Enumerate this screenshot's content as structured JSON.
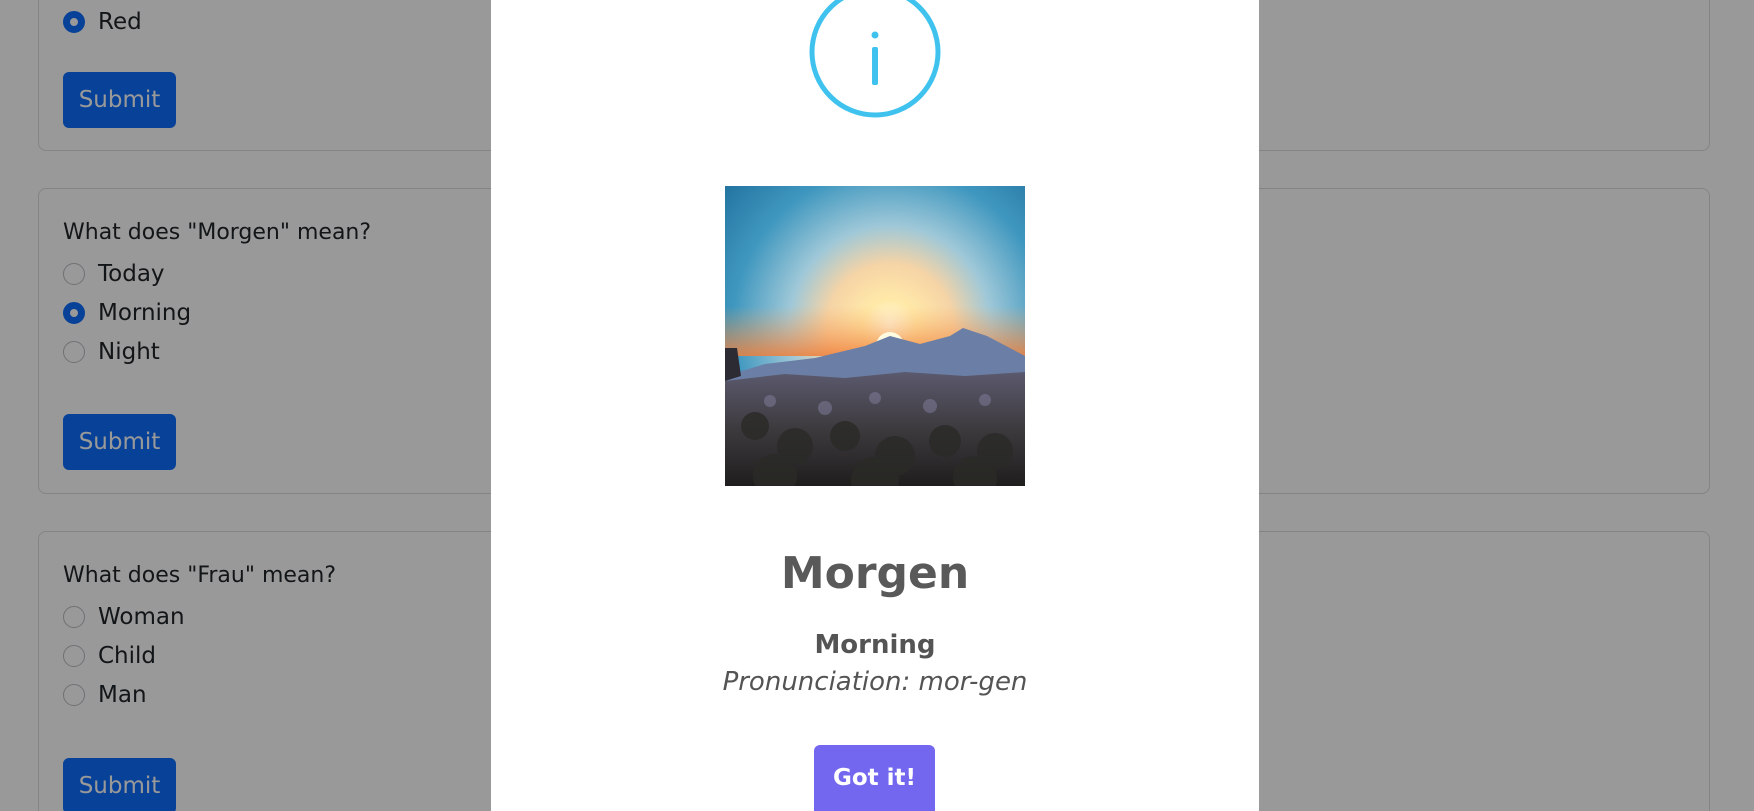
{
  "quiz": {
    "card1": {
      "options": [
        {
          "label": "Red",
          "checked": true
        }
      ],
      "submit_label": "Submit"
    },
    "card2": {
      "question": "What does \"Morgen\" mean?",
      "options": [
        {
          "label": "Today",
          "checked": false
        },
        {
          "label": "Morning",
          "checked": true
        },
        {
          "label": "Night",
          "checked": false
        }
      ],
      "submit_label": "Submit"
    },
    "card3": {
      "question": "What does \"Frau\" mean?",
      "options": [
        {
          "label": "Woman",
          "checked": false
        },
        {
          "label": "Child",
          "checked": false
        },
        {
          "label": "Man",
          "checked": false
        }
      ],
      "submit_label": "Submit"
    }
  },
  "modal": {
    "icon": "info-icon",
    "image": "sunrise-over-mountains",
    "title": "Morgen",
    "translation": "Morning",
    "pronunciation": "Pronunciation: mor-gen",
    "confirm_label": "Got it!"
  },
  "colors": {
    "primary": "#0d6efd",
    "confirm": "#7367f0",
    "info_icon": "#3fc3ee",
    "text_muted": "#545454"
  }
}
